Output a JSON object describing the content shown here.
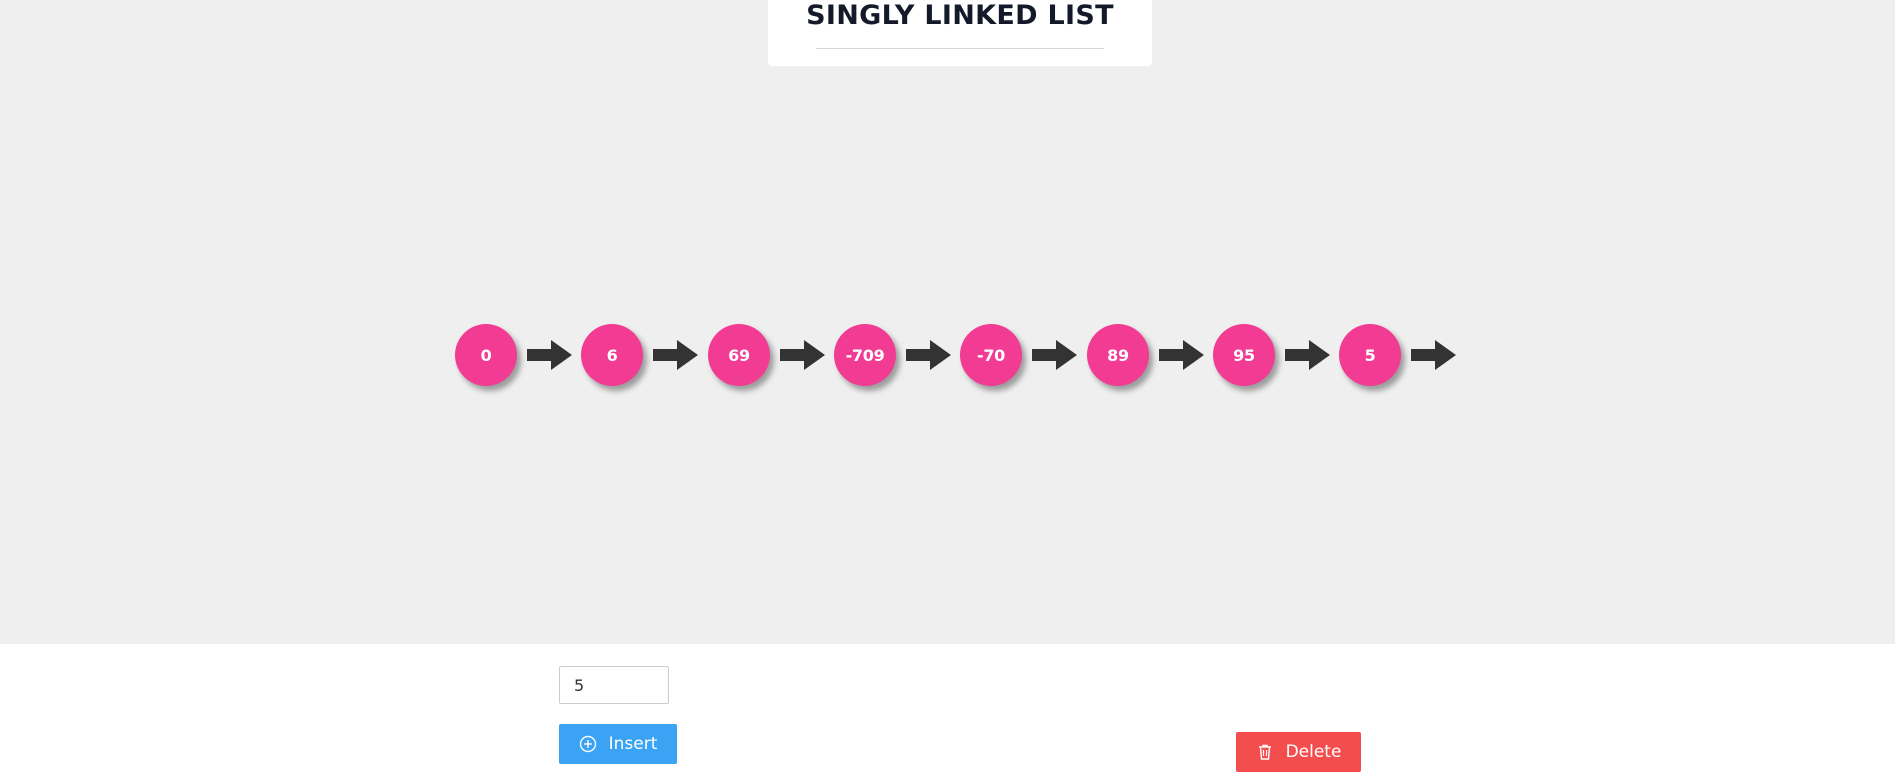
{
  "header": {
    "title": "SINGLY LINKED LIST"
  },
  "linked_list": {
    "nodes": [
      "0",
      "6",
      "69",
      "-709",
      "-70",
      "89",
      "95",
      "5"
    ],
    "node_color": "#f23c93",
    "arrow_color": "#333333"
  },
  "controls": {
    "input_value": "5",
    "insert_label": "Insert",
    "insert_icon": "plus-circle-icon",
    "insert_color": "#3aa3f4",
    "delete_label": "Delete",
    "delete_icon": "trash-icon",
    "delete_color": "#f44d4d"
  }
}
